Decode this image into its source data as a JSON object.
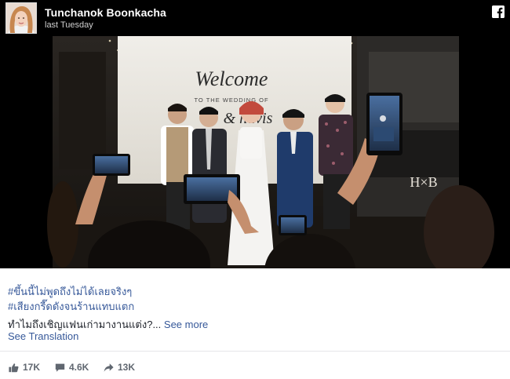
{
  "post": {
    "author": "Tunchanok Boonkacha",
    "timestamp": "last Tuesday",
    "hashtags": [
      "#ขึ้นนี้ไม่พูดถึงไม่ได้เลยจริงๆ",
      "#เสียงกรี๊ดดังจนร้านแทบแตก"
    ],
    "caption": "ทำไมถึงเชิญแฟนเก่ามางานแต่ง?",
    "ellipsis": "...",
    "see_more": "See more",
    "see_translation": "See Translation"
  },
  "photo": {
    "banner_title": "Welcome",
    "banner_subtitle": "TO THE WEDDING OF",
    "banner_names": "& havis",
    "corner_logo": "H×B"
  },
  "stats": {
    "likes": "17K",
    "comments": "4.6K",
    "shares": "13K"
  },
  "icons": {
    "platform": "facebook-icon",
    "like": "like-icon",
    "comment": "comment-icon",
    "share": "share-icon"
  },
  "colors": {
    "link": "#365899",
    "header_bg": "#000000",
    "meta_gray": "#606770"
  }
}
